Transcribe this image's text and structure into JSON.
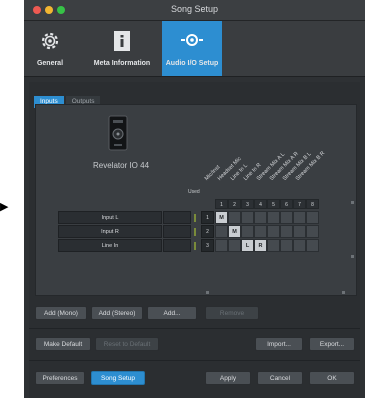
{
  "window": {
    "title": "Song Setup"
  },
  "toolbar": {
    "items": [
      {
        "label": "General",
        "icon": "gear-icon"
      },
      {
        "label": "Meta Information",
        "icon": "info-icon"
      },
      {
        "label": "Audio I/O Setup",
        "icon": "audio-io-icon",
        "active": true
      }
    ]
  },
  "tabs": [
    {
      "label": "Inputs",
      "active": true
    },
    {
      "label": "Outputs",
      "active": false
    }
  ],
  "device": {
    "name": "Revelator IO 44",
    "icon": "audio-interface-icon"
  },
  "matrix": {
    "used_label": "Used",
    "columns": [
      "Mic/Inst",
      "Headset Mic",
      "Line In L",
      "Line In R",
      "Stream Mix A L",
      "Stream Mix A R",
      "Stream Mix B L",
      "Stream Mix B R"
    ],
    "column_numbers": [
      "1",
      "2",
      "3",
      "4",
      "5",
      "6",
      "7",
      "8"
    ],
    "rows": [
      {
        "name": "Input L",
        "number": "1",
        "marks": [
          "M",
          "",
          "",
          "",
          "",
          "",
          "",
          ""
        ]
      },
      {
        "name": "Input R",
        "number": "2",
        "marks": [
          "",
          "M",
          "",
          "",
          "",
          "",
          "",
          ""
        ]
      },
      {
        "name": "Line In",
        "number": "3",
        "marks": [
          "",
          "",
          "L",
          "R",
          "",
          "",
          "",
          ""
        ]
      }
    ]
  },
  "actions": {
    "add_mono": "Add (Mono)",
    "add_stereo": "Add (Stereo)",
    "add": "Add...",
    "remove": "Remove",
    "make_default": "Make Default",
    "reset_default": "Reset to Default",
    "import": "Import...",
    "export": "Export..."
  },
  "footer": {
    "preferences": "Preferences",
    "song_setup": "Song Setup",
    "apply": "Apply",
    "cancel": "Cancel",
    "ok": "OK"
  },
  "colors": {
    "accent": "#2d8ed1",
    "background": "#2e3134"
  }
}
